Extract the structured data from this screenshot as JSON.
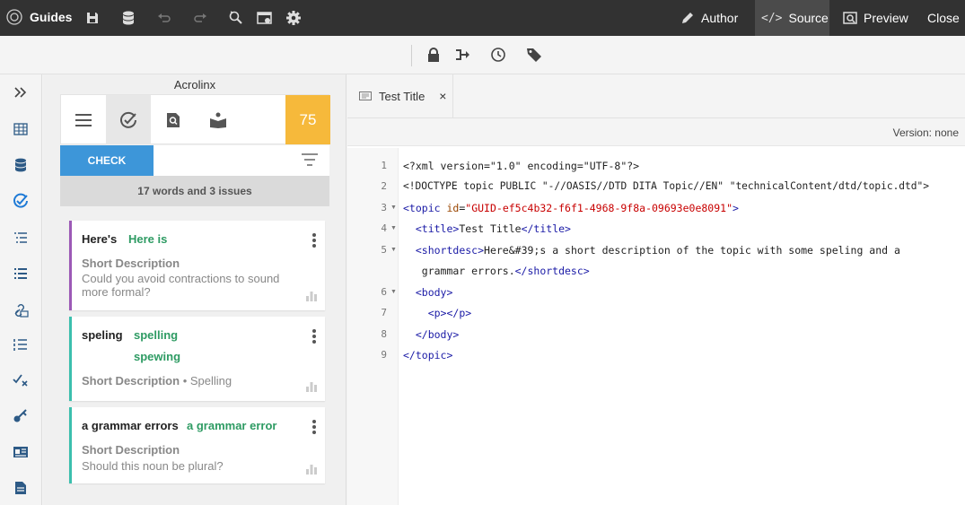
{
  "topbar": {
    "app_name": "Guides",
    "author_label": "Author",
    "source_label": "Source",
    "preview_label": "Preview",
    "close_label": "Close"
  },
  "panel": {
    "title": "Acrolinx",
    "score": "75",
    "check_label": "CHECK",
    "summary": "17 words and 3 issues",
    "cards": [
      {
        "issue": "Here's",
        "suggestions": [
          "Here is"
        ],
        "label": "Short Description",
        "category": "",
        "description": "Could you avoid contractions to sound more formal?",
        "color": "#9c59b6"
      },
      {
        "issue": "speling",
        "suggestions": [
          "spelling",
          "spewing"
        ],
        "label": "Short Description",
        "category": " • Spelling",
        "description": "",
        "color": "#3bbfad"
      },
      {
        "issue": "a grammar errors",
        "suggestions": [
          "a grammar error"
        ],
        "label": "Short Description",
        "category": "",
        "description": "Should this noun be plural?",
        "color": "#3bbfad"
      }
    ]
  },
  "editor": {
    "tab_title": "Test Title",
    "version": "Version: none",
    "line_numbers": [
      "1",
      "2",
      "3",
      "4",
      "5",
      "6",
      "7",
      "8",
      "9"
    ]
  },
  "colors": {
    "accent": "#3d96d9",
    "score": "#f6b93b",
    "topbar": "#323232"
  }
}
